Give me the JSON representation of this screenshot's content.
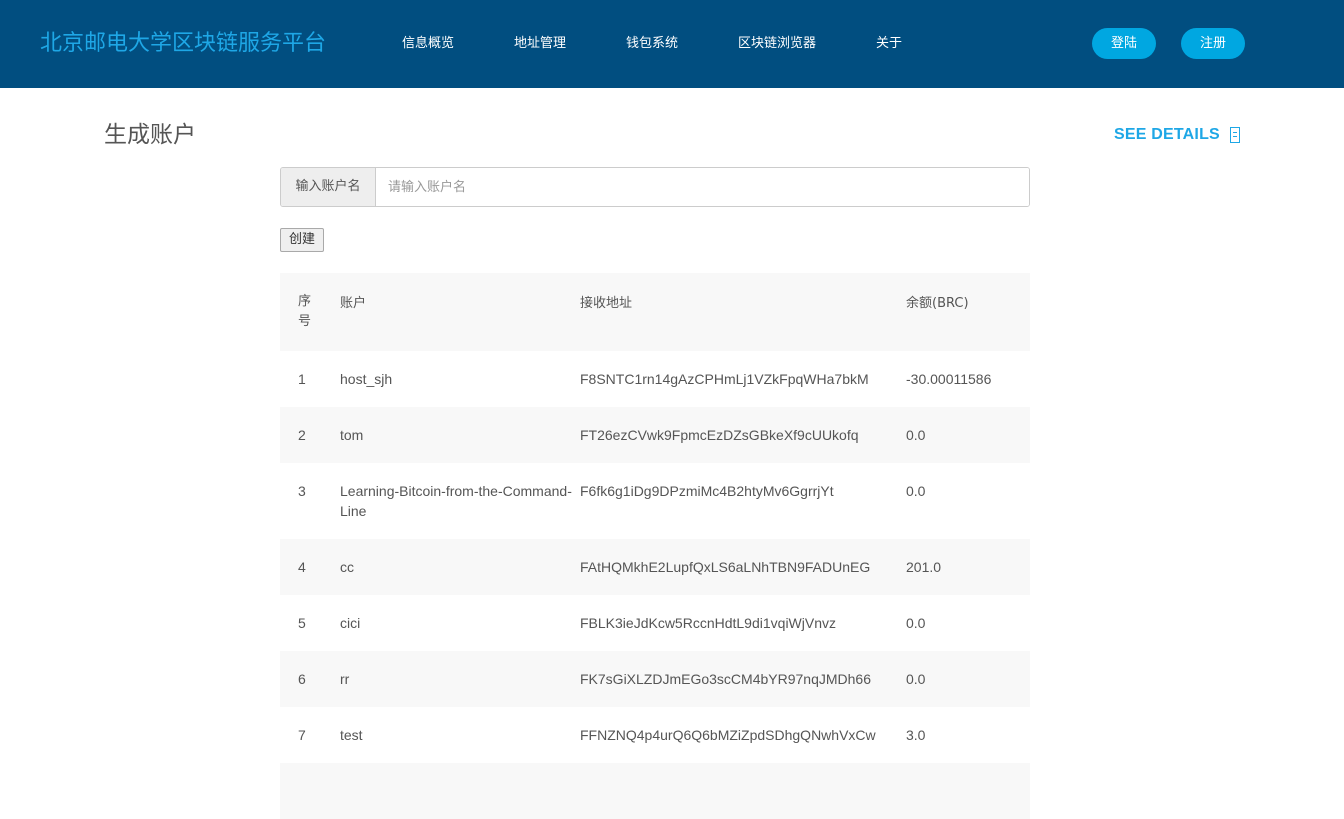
{
  "header": {
    "brand": "北京邮电大学区块链服务平台",
    "nav": [
      "信息概览",
      "地址管理",
      "钱包系统",
      "区块链浏览器",
      "关于"
    ],
    "login_label": "登陆",
    "register_label": "注册"
  },
  "page": {
    "title": "生成账户",
    "see_details_label": "SEE DETAILS"
  },
  "form": {
    "addon_label": "输入账户名",
    "input_placeholder": "请输入账户名",
    "input_value": "",
    "create_label": "创建"
  },
  "table": {
    "headers": [
      "序号",
      "账户",
      "接收地址",
      "余额(BRC)"
    ],
    "rows": [
      {
        "idx": "1",
        "account": "host_sjh",
        "address": "F8SNTC1rn14gAzCPHmLj1VZkFpqWHa7bkM",
        "balance": "-30.00011586"
      },
      {
        "idx": "2",
        "account": "tom",
        "address": "FT26ezCVwk9FpmcEzDZsGBkeXf9cUUkofq",
        "balance": "0.0"
      },
      {
        "idx": "3",
        "account": "Learning-Bitcoin-from-the-Command-Line",
        "address": "F6fk6g1iDg9DPzmiMc4B2htyMv6GgrrjYt",
        "balance": "0.0"
      },
      {
        "idx": "4",
        "account": "cc",
        "address": "FAtHQMkhE2LupfQxLS6aLNhTBN9FADUnEG",
        "balance": "201.0"
      },
      {
        "idx": "5",
        "account": "cici",
        "address": "FBLK3ieJdKcw5RccnHdtL9di1vqiWjVnvz",
        "balance": "0.0"
      },
      {
        "idx": "6",
        "account": "rr",
        "address": "FK7sGiXLZDJmEGo3scCM4bYR97nqJMDh66",
        "balance": "0.0"
      },
      {
        "idx": "7",
        "account": "test",
        "address": "FFNZNQ4p4urQ6Q6bMZiZpdSDhgQNwhVxCw",
        "balance": "3.0"
      }
    ]
  },
  "icons": {
    "see_details": "document-icon"
  },
  "colors": {
    "header_bg": "#014e80",
    "brand": "#1ea7e6",
    "button_bg": "#00a7e1",
    "row_alt": "#f8f8f8"
  }
}
